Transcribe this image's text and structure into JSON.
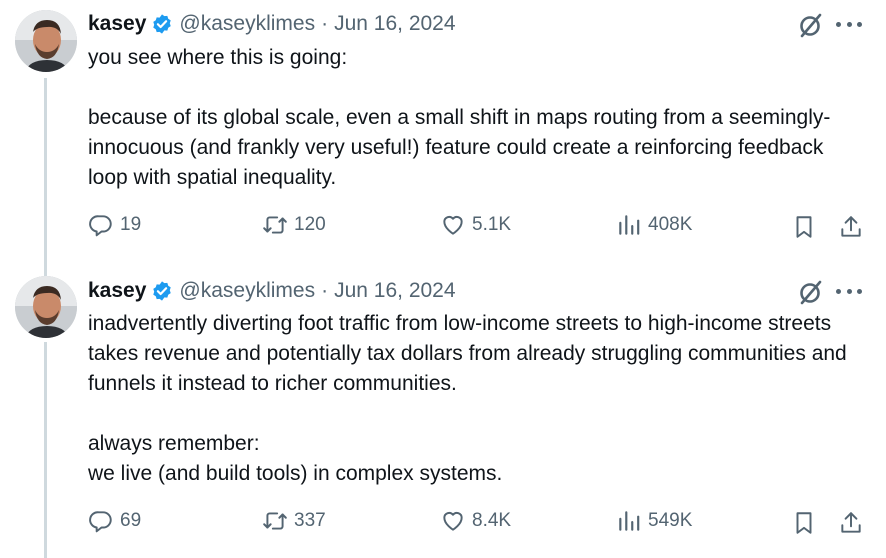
{
  "tweets": [
    {
      "author": {
        "name": "kasey",
        "handle": "@kaseyklimes",
        "date": "Jun 16, 2024",
        "verified": true
      },
      "separator": "·",
      "paragraphs": [
        "you see where this is going:",
        "",
        "because of its global scale, even a small shift in maps routing from a seemingly-innocuous (and frankly very useful!) feature could create a reinforcing feedback loop with spatial inequality."
      ],
      "stats": {
        "replies": "19",
        "reposts": "120",
        "likes": "5.1K",
        "views": "408K"
      }
    },
    {
      "author": {
        "name": "kasey",
        "handle": "@kaseyklimes",
        "date": "Jun 16, 2024",
        "verified": true
      },
      "separator": "·",
      "paragraphs": [
        "inadvertently diverting foot traffic from low-income streets to high-income streets takes revenue and potentially tax dollars from already struggling communities and funnels it instead to richer communities.",
        "",
        "always remember:",
        "we live (and build tools) in complex systems."
      ],
      "stats": {
        "replies": "69",
        "reposts": "337",
        "likes": "8.4K",
        "views": "549K"
      }
    }
  ],
  "icons": {
    "reply": "reply-icon",
    "repost": "repost-icon",
    "like": "like-icon",
    "views": "views-icon",
    "bookmark": "bookmark-icon",
    "share": "share-icon",
    "grok": "grok-icon",
    "more": "more-icon",
    "verified": "verified-badge-icon"
  },
  "colors": {
    "text": "#0f1419",
    "secondary": "#536471",
    "verified": "#1d9bf0",
    "thread_line": "#cfd9de"
  }
}
